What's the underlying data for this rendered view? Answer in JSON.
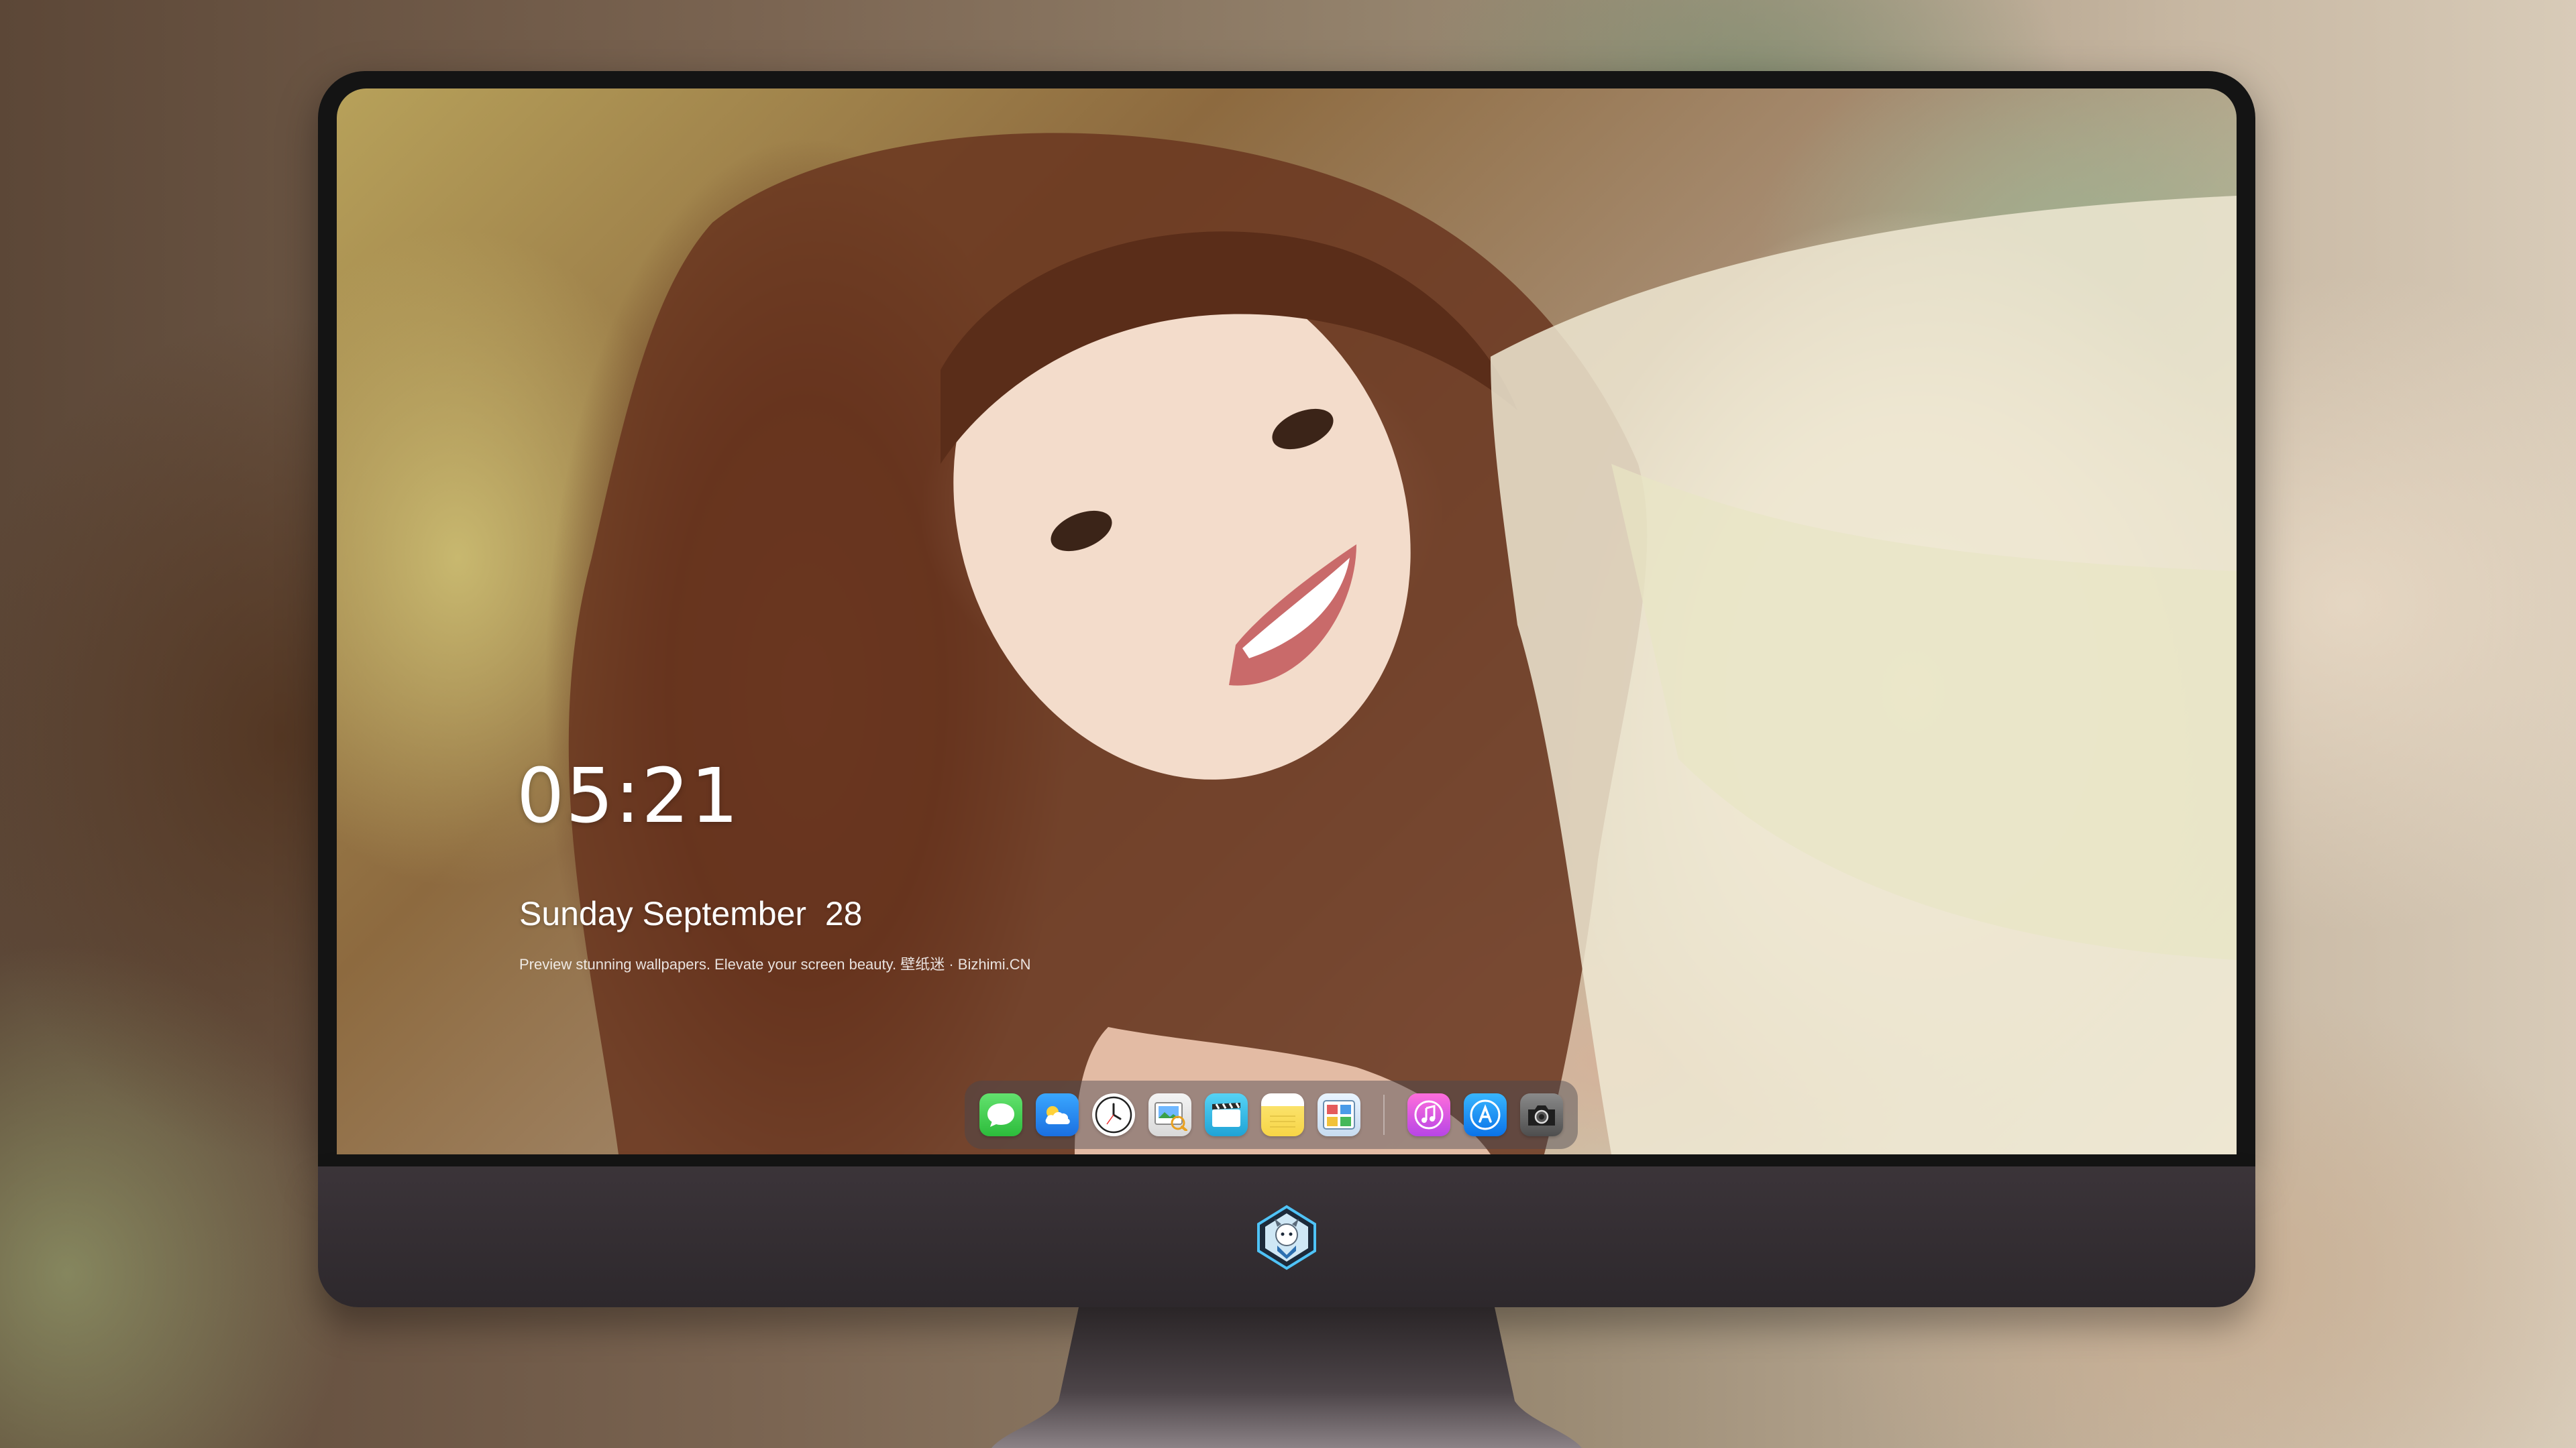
{
  "lock_screen": {
    "time": "05:21",
    "date": "Sunday September  28",
    "tagline": "Preview stunning wallpapers. Elevate your screen beauty. 壁纸迷 · Bizhimi.CN"
  },
  "dock": {
    "apps": [
      {
        "name": "messages-icon"
      },
      {
        "name": "weather-icon"
      },
      {
        "name": "clock-icon"
      },
      {
        "name": "preview-icon"
      },
      {
        "name": "video-editor-icon"
      },
      {
        "name": "notes-icon"
      },
      {
        "name": "photos-icon"
      },
      {
        "name": "music-icon"
      },
      {
        "name": "app-store-icon"
      },
      {
        "name": "camera-icon"
      }
    ]
  },
  "colors": {
    "bezel": "#141414",
    "chin": "#342e33",
    "text": "#ffffff"
  }
}
